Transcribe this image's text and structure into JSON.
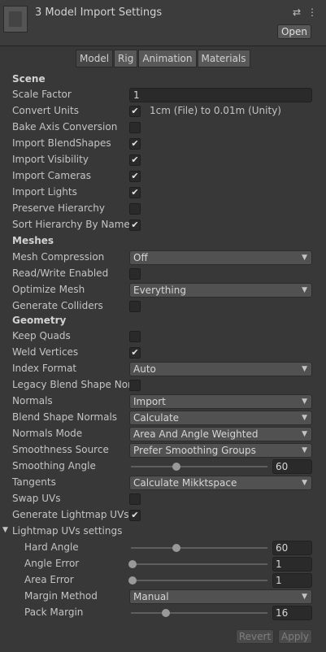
{
  "header": {
    "title": "3 Model Import Settings",
    "open_label": "Open",
    "settings_icon": "⇄",
    "menu_icon": "⋮"
  },
  "tabs": [
    "Model",
    "Rig",
    "Animation",
    "Materials"
  ],
  "scene": {
    "heading": "Scene",
    "scale_factor_label": "Scale Factor",
    "scale_factor_value": "1",
    "convert_units_label": "Convert Units",
    "convert_units_caption": "1cm (File) to 0.01m (Unity)",
    "bake_axis_label": "Bake Axis Conversion",
    "import_blendshapes_label": "Import BlendShapes",
    "import_visibility_label": "Import Visibility",
    "import_cameras_label": "Import Cameras",
    "import_lights_label": "Import Lights",
    "preserve_hierarchy_label": "Preserve Hierarchy",
    "sort_hierarchy_label": "Sort Hierarchy By Name"
  },
  "meshes": {
    "heading": "Meshes",
    "mesh_compression_label": "Mesh Compression",
    "mesh_compression_value": "Off",
    "read_write_label": "Read/Write Enabled",
    "optimize_mesh_label": "Optimize Mesh",
    "optimize_mesh_value": "Everything",
    "generate_colliders_label": "Generate Colliders"
  },
  "geometry": {
    "heading": "Geometry",
    "keep_quads_label": "Keep Quads",
    "weld_vertices_label": "Weld Vertices",
    "index_format_label": "Index Format",
    "index_format_value": "Auto",
    "legacy_blend_label": "Legacy Blend Shape Normals",
    "normals_label": "Normals",
    "normals_value": "Import",
    "blend_shape_normals_label": "Blend Shape Normals",
    "blend_shape_normals_value": "Calculate",
    "normals_mode_label": "Normals Mode",
    "normals_mode_value": "Area And Angle Weighted",
    "smoothness_source_label": "Smoothness Source",
    "smoothness_source_value": "Prefer Smoothing Groups",
    "smoothing_angle_label": "Smoothing Angle",
    "smoothing_angle_value": "60",
    "tangents_label": "Tangents",
    "tangents_value": "Calculate Mikktspace",
    "swap_uvs_label": "Swap UVs",
    "generate_lightmap_uvs_label": "Generate Lightmap UVs"
  },
  "lightmap": {
    "heading": "Lightmap UVs settings",
    "hard_angle_label": "Hard Angle",
    "hard_angle_value": "60",
    "angle_error_label": "Angle Error",
    "angle_error_value": "1",
    "area_error_label": "Area Error",
    "area_error_value": "1",
    "margin_method_label": "Margin Method",
    "margin_method_value": "Manual",
    "pack_margin_label": "Pack Margin",
    "pack_margin_value": "16"
  },
  "checkboxes": {
    "convert_units": true,
    "bake_axis": false,
    "import_blendshapes": true,
    "import_visibility": true,
    "import_cameras": true,
    "import_lights": true,
    "preserve_hierarchy": false,
    "sort_hierarchy": true,
    "read_write": false,
    "generate_colliders": false,
    "keep_quads": false,
    "weld_vertices": true,
    "legacy_blend": false,
    "swap_uvs": false,
    "generate_lightmap_uvs": true
  },
  "sliders": {
    "smoothing_angle": 0.33,
    "hard_angle": 0.33,
    "angle_error": 0.0,
    "area_error": 0.0,
    "pack_margin": 0.25
  },
  "footer": {
    "revert_label": "Revert",
    "apply_label": "Apply"
  },
  "colors": {
    "background": "#383838",
    "header": "#3c3c3c",
    "field": "#2a2a2a",
    "dropdown": "#515151"
  }
}
